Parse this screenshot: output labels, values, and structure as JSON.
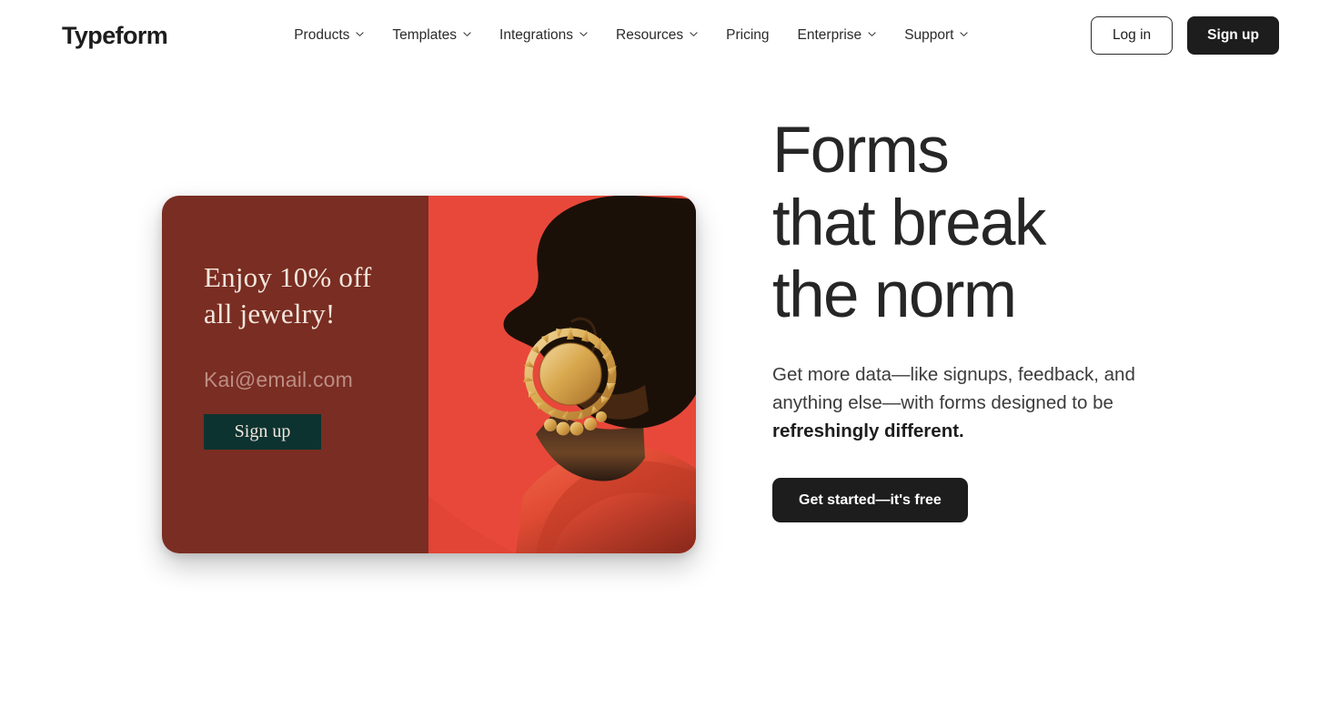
{
  "brand": {
    "name": "Typeform"
  },
  "nav": {
    "items": [
      {
        "label": "Products",
        "caret": true
      },
      {
        "label": "Templates",
        "caret": true
      },
      {
        "label": "Integrations",
        "caret": true
      },
      {
        "label": "Resources",
        "caret": true
      },
      {
        "label": "Pricing",
        "caret": false
      },
      {
        "label": "Enterprise",
        "caret": true
      },
      {
        "label": "Support",
        "caret": true
      }
    ]
  },
  "auth": {
    "login_label": "Log in",
    "signup_label": "Sign up"
  },
  "hero": {
    "headline_lines": [
      "Forms",
      "that break",
      "the norm"
    ],
    "subcopy_plain": "Get more data—like signups, feedback, and anything else—with forms designed to be ",
    "subcopy_bold": "refreshingly different.",
    "cta_label": "Get started—it's free"
  },
  "form_card": {
    "offer_line1": "Enjoy 10% off",
    "offer_line2": "all jewelry!",
    "email_placeholder": "Kai@email.com",
    "submit_label": "Sign up",
    "panel_color": "#7a2d22",
    "submit_color": "#0d3330",
    "photo_bg_color": "#e8483a",
    "photo_alt": "profile silhouette with gold hoop earring"
  },
  "colors": {
    "page_bg": "#ffffff",
    "text_dark": "#1d1d1d",
    "headline": "#262627",
    "accent_dark": "#1d1d1d"
  }
}
